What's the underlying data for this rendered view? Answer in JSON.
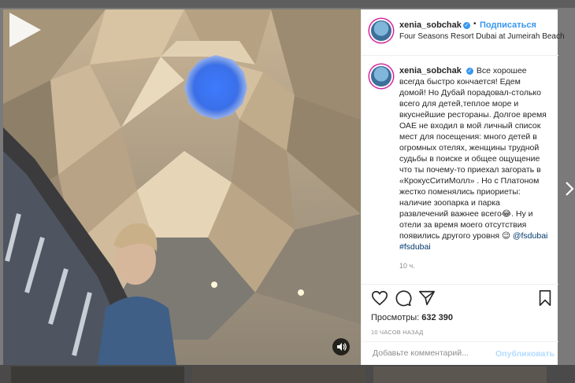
{
  "post": {
    "username": "xenia_sobchak",
    "verified_mark": "✓",
    "follow_label": "Подписаться",
    "separator": "•",
    "location": "Four Seasons Resort Dubai at Jumeirah Beach",
    "caption_text": "Все хорошее всегда быстро кончается! Едем домой! Но Дубай порадовал-столько всего для детей,теплое море и вкуснейшие рестораны. Долгое время ОАЕ не входил в мой личный список мест для посещения: много детей в огромных отелях, женщины трудной судьбы в поиске и общее ощущение что ты почему-то приехал загорать в «КрокусСитиМолл» . Но с Платоном жестко поменялись приориеты: наличие зоопарка и парка развлечений важнее всего😂. Ну и отели за время моего отсутствия появились другого уровня 😉 ",
    "tag1": "@fsdubai",
    "tag2": "#fsdubai",
    "caption_time": "10 ч.",
    "views_label": "Просмотры:",
    "views_count": "632 390",
    "posted_ago": "10 ЧАСОВ НАЗАД",
    "comment_placeholder": "Добавьте комментарий...",
    "publish_label": "Опубликовать"
  },
  "icons": [
    "play-icon",
    "sound-icon",
    "heart-icon",
    "comment-icon",
    "share-icon",
    "bookmark-icon",
    "chevron-right-icon",
    "verified-badge-icon"
  ],
  "colors": {
    "link": "#3897f0",
    "tag": "#00376b",
    "muted": "#8e8e8e",
    "text": "#262626",
    "publish_disabled": "#b3dbff"
  }
}
